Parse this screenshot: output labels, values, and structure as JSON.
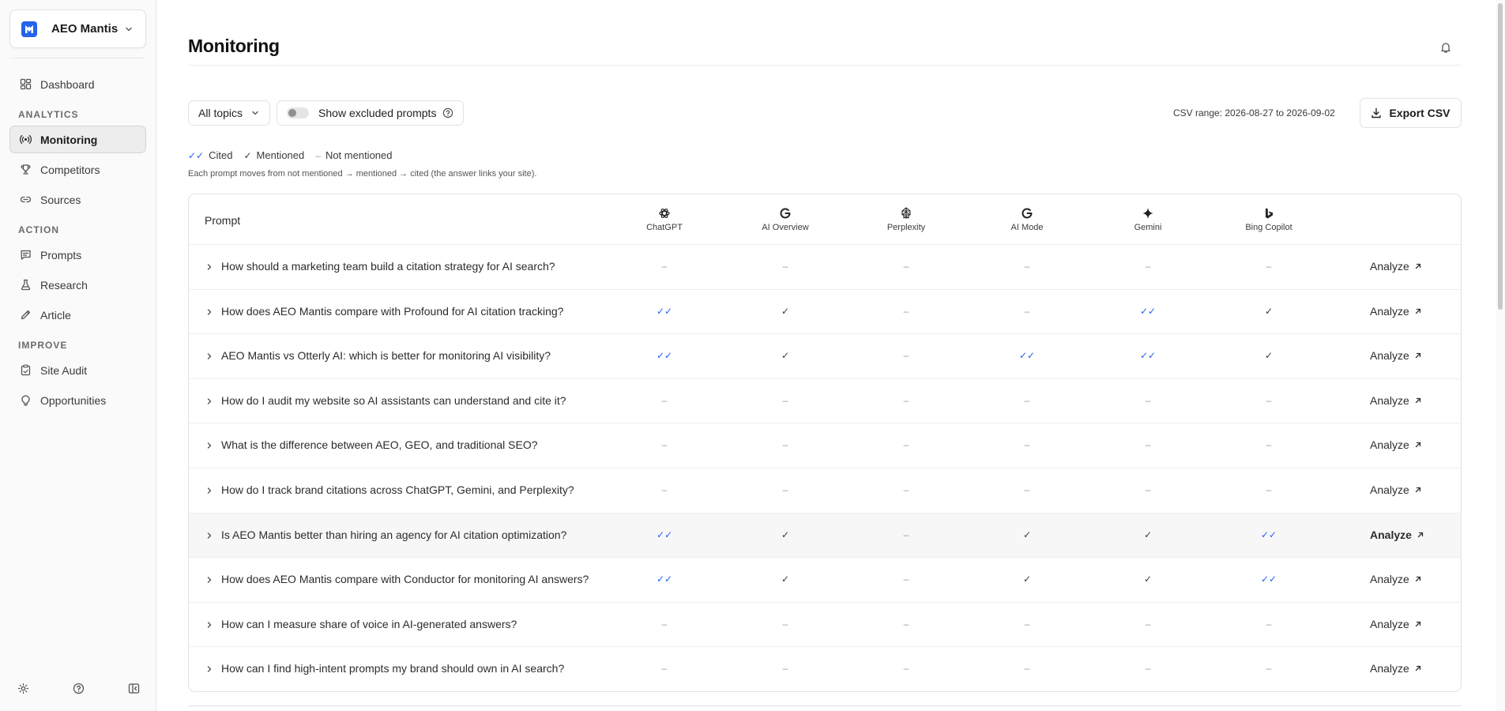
{
  "workspace": {
    "name": "AEO Mantis"
  },
  "nav": {
    "top_items": [
      {
        "label": "Dashboard",
        "icon": "dashboard-icon"
      }
    ],
    "sections": [
      {
        "title": "ANALYTICS",
        "items": [
          {
            "label": "Monitoring",
            "icon": "broadcast-icon",
            "active": true
          },
          {
            "label": "Competitors",
            "icon": "trophy-icon"
          },
          {
            "label": "Sources",
            "icon": "link-icon"
          }
        ]
      },
      {
        "title": "ACTION",
        "items": [
          {
            "label": "Prompts",
            "icon": "message-icon"
          },
          {
            "label": "Research",
            "icon": "flask-icon"
          },
          {
            "label": "Article",
            "icon": "pencil-icon"
          }
        ]
      },
      {
        "title": "IMPROVE",
        "items": [
          {
            "label": "Site Audit",
            "icon": "clipboard-icon"
          },
          {
            "label": "Opportunities",
            "icon": "lightbulb-icon"
          }
        ]
      }
    ]
  },
  "page": {
    "title": "Monitoring"
  },
  "toolbar": {
    "topic_filter": "All topics",
    "show_excluded_label": "Show excluded prompts",
    "csv_range": "CSV range: 2026-08-27 to 2026-09-02",
    "export_label": "Export CSV"
  },
  "legend": {
    "cited_mark": "✓✓",
    "cited": "Cited",
    "mentioned_mark": "✓",
    "mentioned": "Mentioned",
    "none_mark": "–",
    "none": "Not mentioned",
    "note": "Each prompt moves from not mentioned → mentioned → cited (the answer links your site)."
  },
  "table": {
    "prompt_header": "Prompt",
    "models": [
      "ChatGPT",
      "AI Overview",
      "Perplexity",
      "AI Mode",
      "Gemini",
      "Bing Copilot"
    ],
    "analyze_label": "Analyze",
    "status_marks": {
      "cited": "✓✓",
      "mentioned": "✓",
      "none": "–"
    },
    "rows": [
      {
        "prompt": "How should a marketing team build a citation strategy for AI search?",
        "status": [
          "none",
          "none",
          "none",
          "none",
          "none",
          "none"
        ]
      },
      {
        "prompt": "How does AEO Mantis compare with Profound for AI citation tracking?",
        "status": [
          "cited",
          "mentioned",
          "none",
          "none",
          "cited",
          "mentioned"
        ]
      },
      {
        "prompt": "AEO Mantis vs Otterly AI: which is better for monitoring AI visibility?",
        "status": [
          "cited",
          "mentioned",
          "none",
          "cited",
          "cited",
          "mentioned"
        ]
      },
      {
        "prompt": "How do I audit my website so AI assistants can understand and cite it?",
        "status": [
          "none",
          "none",
          "none",
          "none",
          "none",
          "none"
        ]
      },
      {
        "prompt": "What is the difference between AEO, GEO, and traditional SEO?",
        "status": [
          "none",
          "none",
          "none",
          "none",
          "none",
          "none"
        ]
      },
      {
        "prompt": "How do I track brand citations across ChatGPT, Gemini, and Perplexity?",
        "status": [
          "none",
          "none",
          "none",
          "none",
          "none",
          "none"
        ]
      },
      {
        "prompt": "Is AEO Mantis better than hiring an agency for AI citation optimization?",
        "status": [
          "cited",
          "mentioned",
          "none",
          "mentioned",
          "mentioned",
          "cited"
        ],
        "highlighted": true
      },
      {
        "prompt": "How does AEO Mantis compare with Conductor for monitoring AI answers?",
        "status": [
          "cited",
          "mentioned",
          "none",
          "mentioned",
          "mentioned",
          "cited"
        ]
      },
      {
        "prompt": "How can I measure share of voice in AI-generated answers?",
        "status": [
          "none",
          "none",
          "none",
          "none",
          "none",
          "none"
        ]
      },
      {
        "prompt": "How can I find high-intent prompts my brand should own in AI search?",
        "status": [
          "none",
          "none",
          "none",
          "none",
          "none",
          "none"
        ]
      }
    ]
  }
}
